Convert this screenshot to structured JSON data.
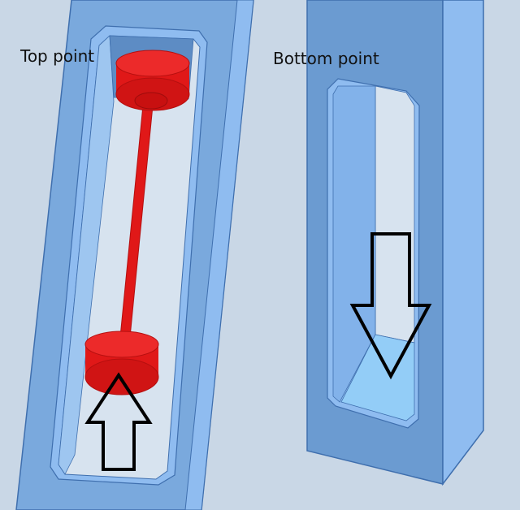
{
  "labels": {
    "top_point": "Top point",
    "bottom_point": "Bottom point"
  },
  "colors": {
    "background": "#c9d7e6",
    "frame_dark": "#6b9bd1",
    "frame_light": "#8fbcf0",
    "frame_edge": "#3f6fae",
    "piston_red": "#e01818",
    "piston_red_dark": "#b50f0f",
    "arrow_stroke": "#000000"
  },
  "arrows": [
    {
      "name": "up-arrow",
      "direction": "up"
    },
    {
      "name": "down-arrow",
      "direction": "down"
    }
  ]
}
